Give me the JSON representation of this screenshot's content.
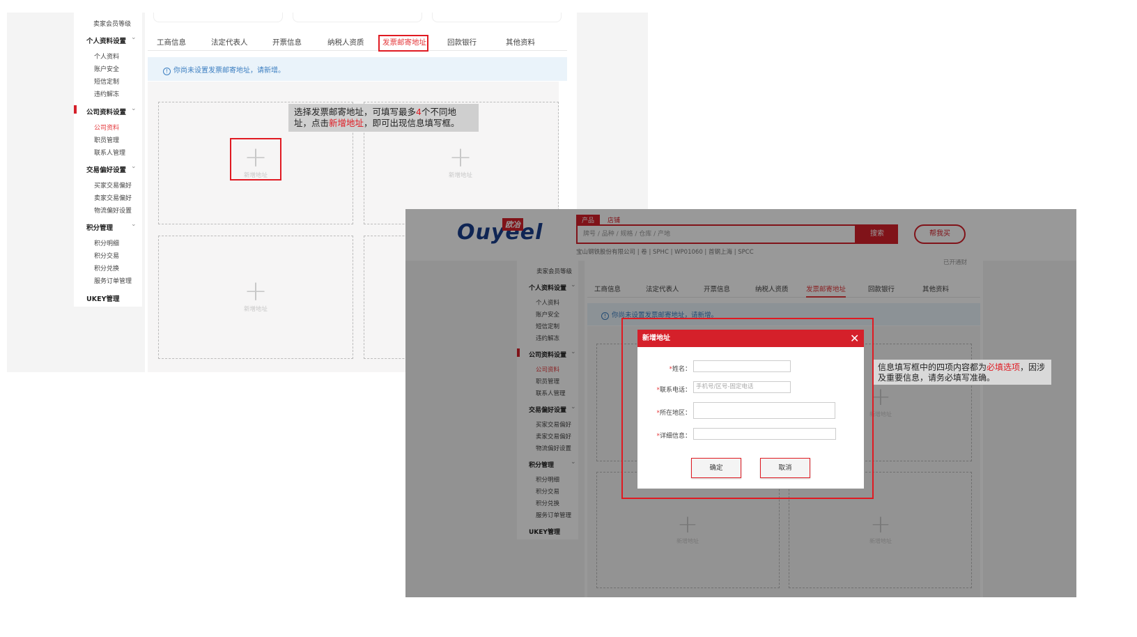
{
  "panel1": {
    "sidebar": {
      "top_item": "卖家会员等级",
      "groups": [
        {
          "title": "个人资料设置",
          "items": [
            "个人资料",
            "账户安全",
            "短信定制",
            "违约解冻"
          ]
        },
        {
          "title": "公司资料设置",
          "items": [
            "公司资料",
            "职员管理",
            "联系人管理"
          ]
        },
        {
          "title": "交易偏好设置",
          "items": [
            "买家交易偏好",
            "卖家交易偏好",
            "物流偏好设置"
          ]
        },
        {
          "title": "积分管理",
          "items": [
            "积分明细",
            "积分交易",
            "积分兑换",
            "服务订单管理"
          ]
        },
        {
          "title": "UKEY管理",
          "items": []
        }
      ]
    },
    "tabs": [
      "工商信息",
      "法定代表人",
      "开票信息",
      "纳税人资质",
      "发票邮寄地址",
      "回款银行",
      "其他资料"
    ],
    "notice": "你尚未设置发票邮寄地址，请新增。",
    "add_address_label": "新增地址",
    "plus_glyph": "+",
    "callout": {
      "part1": "选择发票邮寄地址，可填写最多",
      "num": "4",
      "part2": "个不同地址，点击",
      "highlight": "新增地址",
      "part3": "，即可出现信息填写框。"
    }
  },
  "panel2": {
    "header": {
      "logo_text": "Ouyeel",
      "logo_cn": "欧冶",
      "search_tabs": [
        "产品",
        "店铺"
      ],
      "search_placeholder": "牌号 / 品种 / 规格 / 仓库 / 产地",
      "search_button": "搜索",
      "buy_button": "帮我买",
      "hot_keywords": "宝山钢铁股份有限公司  |  卷  |  SPHC  |  WP01060  |  首钢上海  |  SPCC",
      "top_right_text": "已开通财"
    },
    "sidebar": {
      "top_item": "卖家会员等级",
      "groups": [
        {
          "title": "个人资料设置",
          "items": [
            "个人资料",
            "账户安全",
            "短信定制",
            "违约解冻"
          ]
        },
        {
          "title": "公司资料设置",
          "items": [
            "公司资料",
            "职员管理",
            "联系人管理"
          ]
        },
        {
          "title": "交易偏好设置",
          "items": [
            "买家交易偏好",
            "卖家交易偏好",
            "物流偏好设置"
          ]
        },
        {
          "title": "积分管理",
          "items": [
            "积分明细",
            "积分交易",
            "积分兑换",
            "服务订单管理"
          ]
        },
        {
          "title": "UKEY管理",
          "items": []
        }
      ]
    },
    "tabs": [
      "工商信息",
      "法定代表人",
      "开票信息",
      "纳税人资质",
      "发票邮寄地址",
      "回款银行",
      "其他资料"
    ],
    "notice": "你尚未设置发票邮寄地址，请新增。",
    "add_address_label": "新增地址",
    "dialog": {
      "title": "新增地址",
      "close_glyph": "✕",
      "fields": [
        {
          "label": "姓名：",
          "placeholder": ""
        },
        {
          "label": "联系电话：",
          "placeholder": "手机号/区号-固定电话"
        },
        {
          "label": "所在地区：",
          "placeholder": ""
        },
        {
          "label": "详细信息：",
          "placeholder": ""
        }
      ],
      "required_mark": "*",
      "confirm": "确定",
      "cancel": "取消"
    },
    "callout": {
      "part1": "信息填写框中的四项内容都为",
      "highlight": "必填选项",
      "part2": "，因涉及重要信息，请务必填写准确。"
    }
  },
  "colors": {
    "brand_red": "#d5202a",
    "link_blue": "#3d7fc1",
    "logo_blue": "#1a3f8c"
  }
}
